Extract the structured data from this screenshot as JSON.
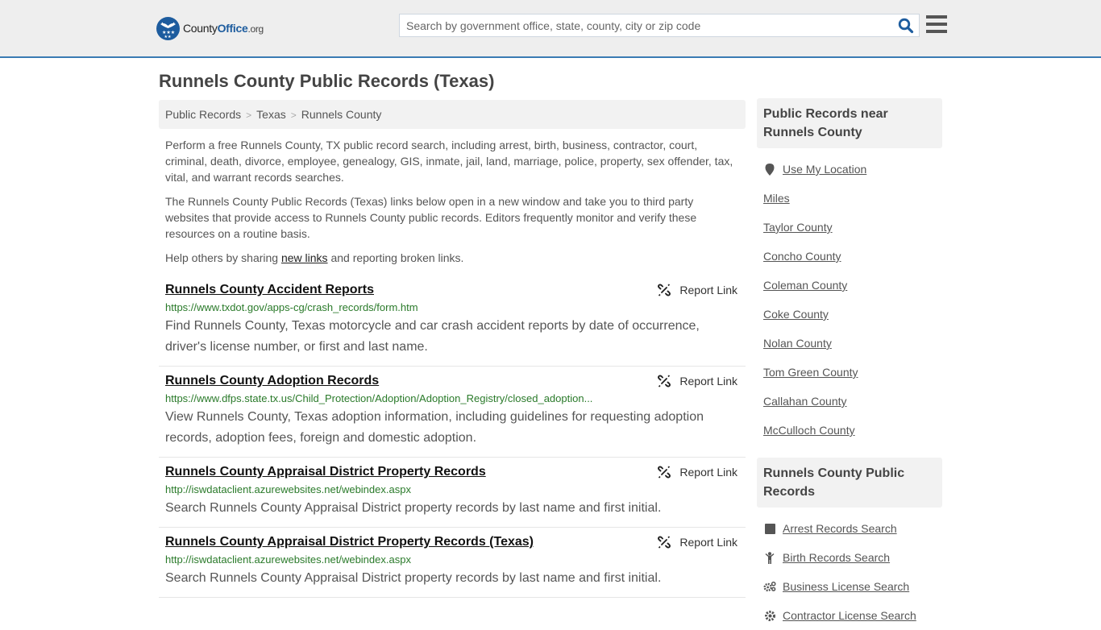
{
  "header": {
    "logo": {
      "name": "County",
      "name_bold": "Office",
      "tld": ".org"
    },
    "search": {
      "placeholder": "Search by government office, state, county, city or zip code",
      "value": ""
    },
    "search_icon": "search-icon",
    "menu_icon": "hamburger-menu-icon"
  },
  "page_title": "Runnels County Public Records (Texas)",
  "breadcrumb": [
    {
      "label": "Public Records"
    },
    {
      "label": "Texas"
    },
    {
      "label": "Runnels County"
    }
  ],
  "breadcrumb_separator": ">",
  "intro": {
    "p1": "Perform a free Runnels County, TX public record search, including arrest, birth, business, contractor, court, criminal, death, divorce, employee, genealogy, GIS, inmate, jail, land, marriage, police, property, sex offender, tax, vital, and warrant records searches.",
    "p2": "The Runnels County Public Records (Texas) links below open in a new window and take you to third party websites that provide access to Runnels County public records. Editors frequently monitor and verify these resources on a routine basis.",
    "p3_before": "Help others by sharing ",
    "p3_link": "new links",
    "p3_after": " and reporting broken links."
  },
  "report_link_label": "Report Link",
  "records": [
    {
      "title": "Runnels County Accident Reports",
      "url": "https://www.txdot.gov/apps-cg/crash_records/form.htm",
      "description": "Find Runnels County, Texas motorcycle and car crash accident reports by date of occurrence, driver's license number, or first and last name."
    },
    {
      "title": "Runnels County Adoption Records",
      "url": "https://www.dfps.state.tx.us/Child_Protection/Adoption/Adoption_Registry/closed_adoption...",
      "description": "View Runnels County, Texas adoption information, including guidelines for requesting adoption records, adoption fees, foreign and domestic adoption."
    },
    {
      "title": "Runnels County Appraisal District Property Records",
      "url": "http://iswdataclient.azurewebsites.net/webindex.aspx",
      "description": "Search Runnels County Appraisal District property records by last name and first initial."
    },
    {
      "title": "Runnels County Appraisal District Property Records (Texas)",
      "url": "http://iswdataclient.azurewebsites.net/webindex.aspx",
      "description": "Search Runnels County Appraisal District property records by last name and first initial."
    }
  ],
  "sidebar": {
    "nearby": {
      "heading": "Public Records near Runnels County",
      "use_location": "Use My Location",
      "items": [
        "Miles",
        "Taylor County",
        "Concho County",
        "Coleman County",
        "Coke County",
        "Nolan County",
        "Tom Green County",
        "Callahan County",
        "McCulloch County"
      ]
    },
    "county_records": {
      "heading": "Runnels County Public Records",
      "items": [
        {
          "label": "Arrest Records Search",
          "icon": "square-icon"
        },
        {
          "label": "Birth Records Search",
          "icon": "child-icon"
        },
        {
          "label": "Business License Search",
          "icon": "cogs-icon"
        },
        {
          "label": "Contractor License Search",
          "icon": "gear-icon"
        }
      ]
    }
  },
  "colors": {
    "brand_blue": "#1d5c9e",
    "header_border": "#3a7bb3",
    "url_green": "#2a7a2a",
    "header_bg": "#eeeeee"
  }
}
